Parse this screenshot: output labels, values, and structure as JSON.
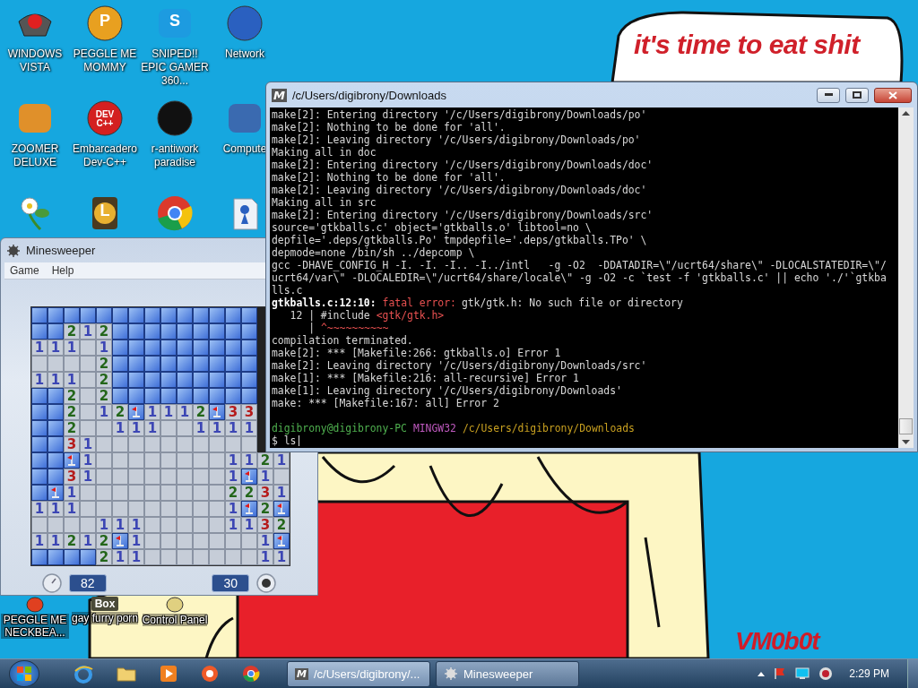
{
  "wallpaper": {
    "caption": "it's time to eat shit",
    "signature": "VM0b0t"
  },
  "desktop": {
    "icons": [
      {
        "label": "WINDOWS VISTA"
      },
      {
        "label": "PEGGLE ME MOMMY",
        "icon_text": "P"
      },
      {
        "label": "SNIPED!! EPIC GAMER 360...",
        "icon_text": "S"
      },
      {
        "label": "Network"
      },
      {
        "label": "ZOOMER DELUXE"
      },
      {
        "label": "Embarcadero Dev-C++",
        "icon_text": "DEV C++"
      },
      {
        "label": "r-antiwork paradise"
      },
      {
        "label": "Compute"
      }
    ],
    "clock_icon_text": "L",
    "bottom_icons": [
      {
        "label": "PEGGLE ME NECKBEA..."
      },
      {
        "label": "gay furry porn",
        "icon_text": "Box"
      },
      {
        "label": "Control Panel"
      }
    ]
  },
  "minesweeper": {
    "title": "Minesweeper",
    "menu": [
      "Game",
      "Help"
    ],
    "board": [
      [
        {
          "kind": "covered"
        },
        {
          "kind": "covered"
        },
        {
          "kind": "covered"
        },
        {
          "kind": "covered"
        },
        {
          "kind": "covered"
        },
        {
          "kind": "covered"
        },
        {
          "kind": "covered"
        },
        {
          "kind": "covered"
        },
        {
          "kind": "covered"
        },
        {
          "kind": "covered"
        },
        {
          "kind": "covered"
        },
        {
          "kind": "covered"
        },
        {
          "kind": "covered"
        },
        {
          "kind": "covered"
        }
      ],
      [
        {
          "kind": "covered"
        },
        {
          "kind": "covered"
        },
        {
          "kind": "number",
          "text": "2"
        },
        {
          "kind": "number",
          "text": "1"
        },
        {
          "kind": "number",
          "text": "2"
        },
        {
          "kind": "covered"
        },
        {
          "kind": "covered"
        },
        {
          "kind": "covered"
        },
        {
          "kind": "covered"
        },
        {
          "kind": "covered"
        },
        {
          "kind": "covered"
        },
        {
          "kind": "covered"
        },
        {
          "kind": "covered"
        },
        {
          "kind": "covered"
        }
      ],
      [
        {
          "kind": "number",
          "text": "1"
        },
        {
          "kind": "number",
          "text": "1"
        },
        {
          "kind": "number",
          "text": "1"
        },
        {
          "kind": "open"
        },
        {
          "kind": "number",
          "text": "1"
        },
        {
          "kind": "covered"
        },
        {
          "kind": "covered"
        },
        {
          "kind": "covered"
        },
        {
          "kind": "covered"
        },
        {
          "kind": "covered"
        },
        {
          "kind": "covered"
        },
        {
          "kind": "covered"
        },
        {
          "kind": "covered"
        },
        {
          "kind": "covered"
        }
      ],
      [
        {
          "kind": "open"
        },
        {
          "kind": "open"
        },
        {
          "kind": "open"
        },
        {
          "kind": "open"
        },
        {
          "kind": "number",
          "text": "2"
        },
        {
          "kind": "covered"
        },
        {
          "kind": "covered"
        },
        {
          "kind": "covered"
        },
        {
          "kind": "covered"
        },
        {
          "kind": "covered"
        },
        {
          "kind": "covered"
        },
        {
          "kind": "covered"
        },
        {
          "kind": "covered"
        },
        {
          "kind": "covered"
        }
      ],
      [
        {
          "kind": "number",
          "text": "1"
        },
        {
          "kind": "number",
          "text": "1"
        },
        {
          "kind": "number",
          "text": "1"
        },
        {
          "kind": "open"
        },
        {
          "kind": "number",
          "text": "2"
        },
        {
          "kind": "covered"
        },
        {
          "kind": "covered"
        },
        {
          "kind": "covered"
        },
        {
          "kind": "covered"
        },
        {
          "kind": "covered"
        },
        {
          "kind": "covered"
        },
        {
          "kind": "covered"
        },
        {
          "kind": "covered"
        },
        {
          "kind": "covered"
        }
      ],
      [
        {
          "kind": "covered"
        },
        {
          "kind": "covered"
        },
        {
          "kind": "number",
          "text": "2"
        },
        {
          "kind": "open"
        },
        {
          "kind": "number",
          "text": "2"
        },
        {
          "kind": "covered"
        },
        {
          "kind": "covered"
        },
        {
          "kind": "covered"
        },
        {
          "kind": "covered"
        },
        {
          "kind": "covered"
        },
        {
          "kind": "covered"
        },
        {
          "kind": "covered"
        },
        {
          "kind": "covered"
        },
        {
          "kind": "covered"
        }
      ],
      [
        {
          "kind": "covered"
        },
        {
          "kind": "covered"
        },
        {
          "kind": "number",
          "text": "2"
        },
        {
          "kind": "open"
        },
        {
          "kind": "number",
          "text": "1"
        },
        {
          "kind": "number",
          "text": "2"
        },
        {
          "kind": "flag"
        },
        {
          "kind": "number",
          "text": "1"
        },
        {
          "kind": "number",
          "text": "1"
        },
        {
          "kind": "number",
          "text": "1"
        },
        {
          "kind": "number",
          "text": "2"
        },
        {
          "kind": "flag"
        },
        {
          "kind": "number",
          "text": "3"
        },
        {
          "kind": "number",
          "text": "3"
        }
      ],
      [
        {
          "kind": "covered"
        },
        {
          "kind": "covered"
        },
        {
          "kind": "number",
          "text": "2"
        },
        {
          "kind": "open"
        },
        {
          "kind": "open"
        },
        {
          "kind": "number",
          "text": "1"
        },
        {
          "kind": "number",
          "text": "1"
        },
        {
          "kind": "number",
          "text": "1"
        },
        {
          "kind": "open"
        },
        {
          "kind": "open"
        },
        {
          "kind": "number",
          "text": "1"
        },
        {
          "kind": "number",
          "text": "1"
        },
        {
          "kind": "number",
          "text": "1"
        },
        {
          "kind": "number",
          "text": "1"
        }
      ],
      [
        {
          "kind": "covered"
        },
        {
          "kind": "covered"
        },
        {
          "kind": "number",
          "text": "3"
        },
        {
          "kind": "number",
          "text": "1"
        },
        {
          "kind": "open"
        },
        {
          "kind": "open"
        },
        {
          "kind": "open"
        },
        {
          "kind": "open"
        },
        {
          "kind": "open"
        },
        {
          "kind": "open"
        },
        {
          "kind": "open"
        },
        {
          "kind": "open"
        },
        {
          "kind": "open"
        },
        {
          "kind": "open"
        }
      ],
      [
        {
          "kind": "covered"
        },
        {
          "kind": "covered"
        },
        {
          "kind": "flag"
        },
        {
          "kind": "number",
          "text": "1"
        },
        {
          "kind": "open"
        },
        {
          "kind": "open"
        },
        {
          "kind": "open"
        },
        {
          "kind": "open"
        },
        {
          "kind": "open"
        },
        {
          "kind": "open"
        },
        {
          "kind": "open"
        },
        {
          "kind": "open"
        },
        {
          "kind": "number",
          "text": "1"
        },
        {
          "kind": "number",
          "text": "1"
        },
        {
          "kind": "number",
          "text": "2"
        },
        {
          "kind": "number",
          "text": "1"
        }
      ],
      [
        {
          "kind": "covered"
        },
        {
          "kind": "covered"
        },
        {
          "kind": "number",
          "text": "3"
        },
        {
          "kind": "number",
          "text": "1"
        },
        {
          "kind": "open"
        },
        {
          "kind": "open"
        },
        {
          "kind": "open"
        },
        {
          "kind": "open"
        },
        {
          "kind": "open"
        },
        {
          "kind": "open"
        },
        {
          "kind": "open"
        },
        {
          "kind": "open"
        },
        {
          "kind": "number",
          "text": "1"
        },
        {
          "kind": "flag"
        },
        {
          "kind": "number",
          "text": "1"
        },
        {
          "kind": "open"
        }
      ],
      [
        {
          "kind": "covered"
        },
        {
          "kind": "flag"
        },
        {
          "kind": "number",
          "text": "1"
        },
        {
          "kind": "open"
        },
        {
          "kind": "open"
        },
        {
          "kind": "open"
        },
        {
          "kind": "open"
        },
        {
          "kind": "open"
        },
        {
          "kind": "open"
        },
        {
          "kind": "open"
        },
        {
          "kind": "open"
        },
        {
          "kind": "open"
        },
        {
          "kind": "number",
          "text": "2"
        },
        {
          "kind": "number",
          "text": "2"
        },
        {
          "kind": "number",
          "text": "3"
        },
        {
          "kind": "number",
          "text": "1"
        }
      ],
      [
        {
          "kind": "number",
          "text": "1"
        },
        {
          "kind": "number",
          "text": "1"
        },
        {
          "kind": "number",
          "text": "1"
        },
        {
          "kind": "open"
        },
        {
          "kind": "open"
        },
        {
          "kind": "open"
        },
        {
          "kind": "open"
        },
        {
          "kind": "open"
        },
        {
          "kind": "open"
        },
        {
          "kind": "open"
        },
        {
          "kind": "open"
        },
        {
          "kind": "open"
        },
        {
          "kind": "number",
          "text": "1"
        },
        {
          "kind": "flag"
        },
        {
          "kind": "number",
          "text": "2"
        },
        {
          "kind": "flag"
        }
      ],
      [
        {
          "kind": "open"
        },
        {
          "kind": "open"
        },
        {
          "kind": "open"
        },
        {
          "kind": "open"
        },
        {
          "kind": "number",
          "text": "1"
        },
        {
          "kind": "number",
          "text": "1"
        },
        {
          "kind": "number",
          "text": "1"
        },
        {
          "kind": "open"
        },
        {
          "kind": "open"
        },
        {
          "kind": "open"
        },
        {
          "kind": "open"
        },
        {
          "kind": "open"
        },
        {
          "kind": "number",
          "text": "1"
        },
        {
          "kind": "number",
          "text": "1"
        },
        {
          "kind": "number",
          "text": "3"
        },
        {
          "kind": "number",
          "text": "2"
        }
      ],
      [
        {
          "kind": "number",
          "text": "1"
        },
        {
          "kind": "number",
          "text": "1"
        },
        {
          "kind": "number",
          "text": "2"
        },
        {
          "kind": "number",
          "text": "1"
        },
        {
          "kind": "number",
          "text": "2"
        },
        {
          "kind": "flag"
        },
        {
          "kind": "number",
          "text": "1"
        },
        {
          "kind": "open"
        },
        {
          "kind": "open"
        },
        {
          "kind": "open"
        },
        {
          "kind": "open"
        },
        {
          "kind": "open"
        },
        {
          "kind": "open"
        },
        {
          "kind": "open"
        },
        {
          "kind": "number",
          "text": "1"
        },
        {
          "kind": "flag"
        }
      ],
      [
        {
          "kind": "covered"
        },
        {
          "kind": "covered"
        },
        {
          "kind": "covered"
        },
        {
          "kind": "covered"
        },
        {
          "kind": "number",
          "text": "2"
        },
        {
          "kind": "number",
          "text": "1"
        },
        {
          "kind": "number",
          "text": "1"
        },
        {
          "kind": "open"
        },
        {
          "kind": "open"
        },
        {
          "kind": "open"
        },
        {
          "kind": "open"
        },
        {
          "kind": "open"
        },
        {
          "kind": "open"
        },
        {
          "kind": "open"
        },
        {
          "kind": "number",
          "text": "1"
        },
        {
          "kind": "number",
          "text": "1"
        }
      ]
    ],
    "time": "82",
    "mines": "30"
  },
  "terminal": {
    "title": "/c/Users/digibrony/Downloads",
    "icon_text": "M",
    "lines": [
      {
        "text": "make[2]: Entering directory '/c/Users/digibrony/Downloads/po'"
      },
      {
        "text": "make[2]: Nothing to be done for 'all'."
      },
      {
        "text": "make[2]: Leaving directory '/c/Users/digibrony/Downloads/po'"
      },
      {
        "text": "Making all in doc"
      },
      {
        "text": "make[2]: Entering directory '/c/Users/digibrony/Downloads/doc'"
      },
      {
        "text": "make[2]: Nothing to be done for 'all'."
      },
      {
        "text": "make[2]: Leaving directory '/c/Users/digibrony/Downloads/doc'"
      },
      {
        "text": "Making all in src"
      },
      {
        "text": "make[2]: Entering directory '/c/Users/digibrony/Downloads/src'"
      },
      {
        "text": "source='gtkballs.c' object='gtkballs.o' libtool=no \\"
      },
      {
        "text": "depfile='.deps/gtkballs.Po' tmpdepfile='.deps/gtkballs.TPo' \\"
      },
      {
        "text": "depmode=none /bin/sh ../depcomp \\"
      },
      {
        "text": "gcc -DHAVE_CONFIG_H -I. -I. -I.. -I../intl   -g -O2  -DDATADIR=\\\"/ucrt64/share\\\" -DLOCALSTATEDIR=\\\"/"
      },
      {
        "text": "ucrt64/var\\\" -DLOCALEDIR=\\\"/ucrt64/share/locale\\\" -g -O2 -c `test -f 'gtkballs.c' || echo './'`gtkba"
      },
      {
        "text": "lls.c"
      },
      {
        "segments": [
          {
            "kind": "bold",
            "text": "gtkballs.c:12:10:"
          },
          {
            "kind": "error",
            "text": "fatal error:"
          },
          {
            "kind": "plain",
            "text": "gtk/gtk.h: No such file or directory"
          }
        ]
      },
      {
        "segments": [
          {
            "kind": "plain",
            "text": "   12 | #include"
          },
          {
            "kind": "error",
            "text": "<gtk/gtk.h>"
          }
        ]
      },
      {
        "segments": [
          {
            "kind": "plain",
            "text": "      |"
          },
          {
            "kind": "error",
            "text": "^~~~~~~~~~~"
          }
        ]
      },
      {
        "text": "compilation terminated."
      },
      {
        "text": "make[2]: *** [Makefile:266: gtkballs.o] Error 1"
      },
      {
        "text": "make[2]: Leaving directory '/c/Users/digibrony/Downloads/src'"
      },
      {
        "text": "make[1]: *** [Makefile:216: all-recursive] Error 1"
      },
      {
        "text": "make[1]: Leaving directory '/c/Users/digibrony/Downloads'"
      },
      {
        "text": "make: *** [Makefile:167: all] Error 2"
      }
    ],
    "prompt": {
      "user": "digibrony@digibrony-PC",
      "system": "MINGW32",
      "path": "/c/Users/digibrony/Downloads",
      "command": "$ ls"
    }
  },
  "taskbar": {
    "tasks": [
      {
        "label": "/c/Users/digibrony/...",
        "icon_text": "M",
        "selected": true
      },
      {
        "label": "Minesweeper",
        "selected": false
      }
    ],
    "clock": "2:29 PM"
  }
}
